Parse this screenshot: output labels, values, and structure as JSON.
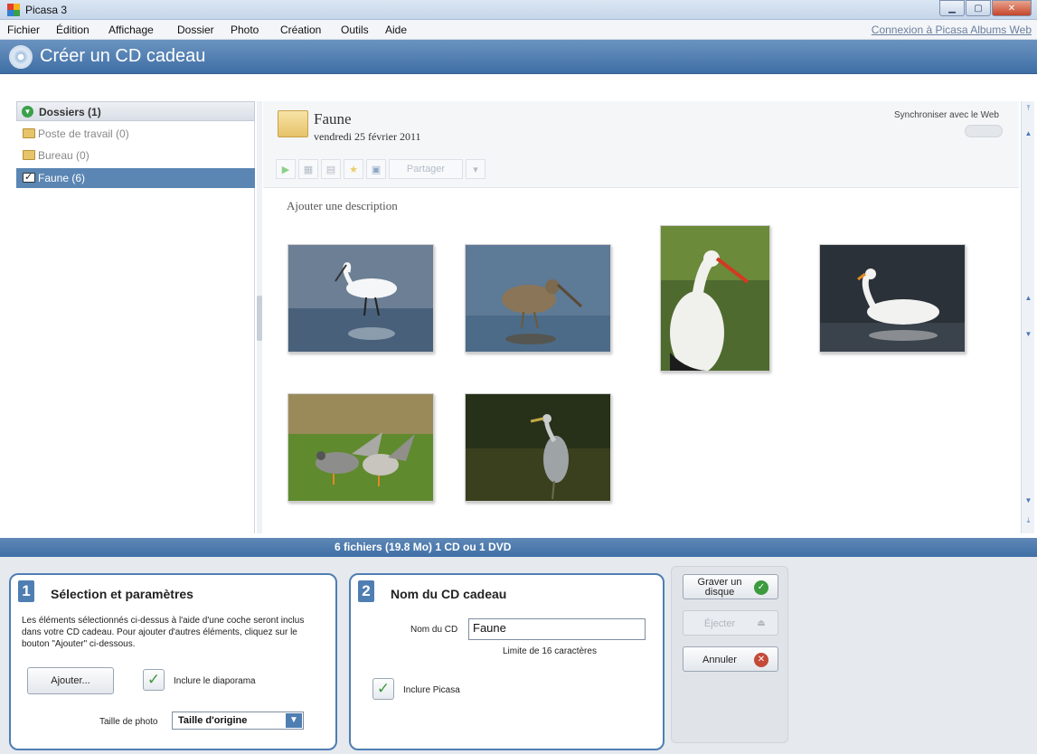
{
  "window": {
    "title": "Picasa 3"
  },
  "menu": {
    "items": [
      "Fichier",
      "Édition",
      "Affichage",
      "Dossier",
      "Photo",
      "Création",
      "Outils",
      "Aide"
    ],
    "web_link": "Connexion à Picasa Albums Web"
  },
  "mode": {
    "title": "Créer un CD cadeau"
  },
  "folders": {
    "header": "Dossiers (1)",
    "items": [
      {
        "label": "Poste de travail (0)",
        "selected": false
      },
      {
        "label": "Bureau (0)",
        "selected": false
      },
      {
        "label": "Faune (6)",
        "selected": true
      }
    ]
  },
  "album": {
    "name": "Faune",
    "date": "vendredi 25 février 2011",
    "sync_label": "Synchroniser avec le Web",
    "share_label": "Partager",
    "description_placeholder": "Ajouter une description"
  },
  "photos": [
    "egret",
    "snipe",
    "stork",
    "swan",
    "geese",
    "heron"
  ],
  "status": {
    "text": "6 fichiers (19.8 Mo) 1 CD ou 1 DVD"
  },
  "step1": {
    "number": "1",
    "title": "Sélection et paramètres",
    "description": "Les éléments sélectionnés ci-dessus à l'aide d'une coche seront inclus dans votre CD cadeau. Pour ajouter d'autres éléments, cliquez sur le bouton \"Ajouter\" ci-dessous.",
    "add_button": "Ajouter...",
    "slideshow_label": "Inclure le diaporama",
    "photo_size_label": "Taille de photo",
    "photo_size_value": "Taille d'origine"
  },
  "step2": {
    "number": "2",
    "title": "Nom du CD cadeau",
    "cd_name_label": "Nom du CD",
    "cd_name_value": "Faune",
    "limit_hint": "Limite de 16 caractères",
    "include_picasa_label": "Inclure Picasa"
  },
  "actions": {
    "burn_label": "Graver un disque",
    "eject_label": "Éjecter",
    "cancel_label": "Annuler"
  },
  "colors": {
    "accent": "#4f7eb3",
    "header": "#3f6fa6",
    "selection": "#5b86b4"
  }
}
